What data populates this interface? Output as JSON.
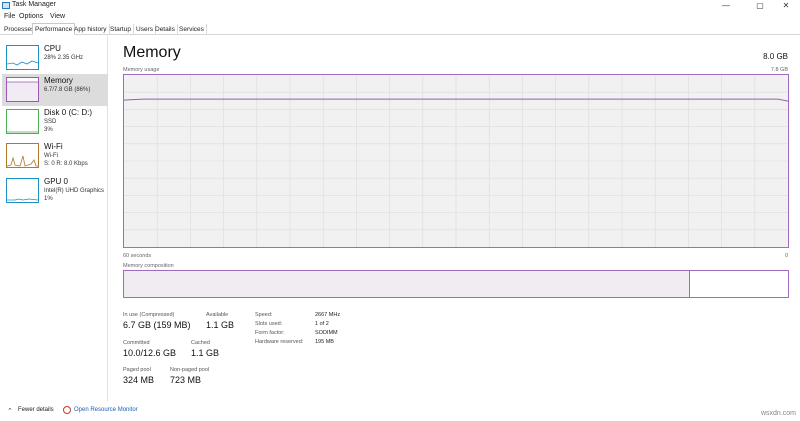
{
  "window": {
    "title": "Task Manager",
    "minimize": "—",
    "maximize": "▢",
    "close": "✕"
  },
  "menu": [
    "File",
    "Options",
    "View"
  ],
  "tabs": [
    "Processes",
    "Performance",
    "App history",
    "Startup",
    "Users",
    "Details",
    "Services"
  ],
  "active_tab": "Performance",
  "sidebar": {
    "items": [
      {
        "name": "CPU",
        "line1": "28% 2.35 GHz",
        "line2": "",
        "color": "#1e90c8",
        "icon": "cpu-graph"
      },
      {
        "name": "Memory",
        "line1": "6.7/7.8 GB (86%)",
        "line2": "",
        "color": "#9b59b6",
        "icon": "memory-graph"
      },
      {
        "name": "Disk 0 (C: D:)",
        "line1": "SSD",
        "line2": "3%",
        "color": "#4caf50",
        "icon": "disk-graph"
      },
      {
        "name": "Wi-Fi",
        "line1": "Wi-Fi",
        "line2": "S: 0 R: 8.0 Kbps",
        "color": "#b07a2a",
        "icon": "wifi-graph"
      },
      {
        "name": "GPU 0",
        "line1": "Intel(R) UHD Graphics",
        "line2": "1%",
        "color": "#1e90c8",
        "icon": "gpu-graph"
      }
    ]
  },
  "main": {
    "title": "Memory",
    "total": "8.0 GB",
    "usage_label": "Memory usage",
    "usage_max": "7.8 GB",
    "time_left": "60 seconds",
    "time_right": "0",
    "composition_label": "Memory composition",
    "composition_used_fraction": 0.852,
    "usage_level_fraction": 0.86,
    "graph_color": "#9b59b6"
  },
  "stats": {
    "in_use_label": "In use (Compressed)",
    "in_use_value": "6.7 GB (159 MB)",
    "available_label": "Available",
    "available_value": "1.1 GB",
    "committed_label": "Committed",
    "committed_value": "10.0/12.6 GB",
    "cached_label": "Cached",
    "cached_value": "1.1 GB",
    "paged_label": "Paged pool",
    "paged_value": "324 MB",
    "nonpaged_label": "Non-paged pool",
    "nonpaged_value": "723 MB"
  },
  "specs": [
    {
      "label": "Speed:",
      "value": "2667 MHz"
    },
    {
      "label": "Slots used:",
      "value": "1 of 2"
    },
    {
      "label": "Form factor:",
      "value": "SODIMM"
    },
    {
      "label": "Hardware reserved:",
      "value": "195 MB"
    }
  ],
  "footer": {
    "fewer_details": "Fewer details",
    "open_resource_monitor": "Open Resource Monitor",
    "watermark": "wsxdn.com"
  }
}
